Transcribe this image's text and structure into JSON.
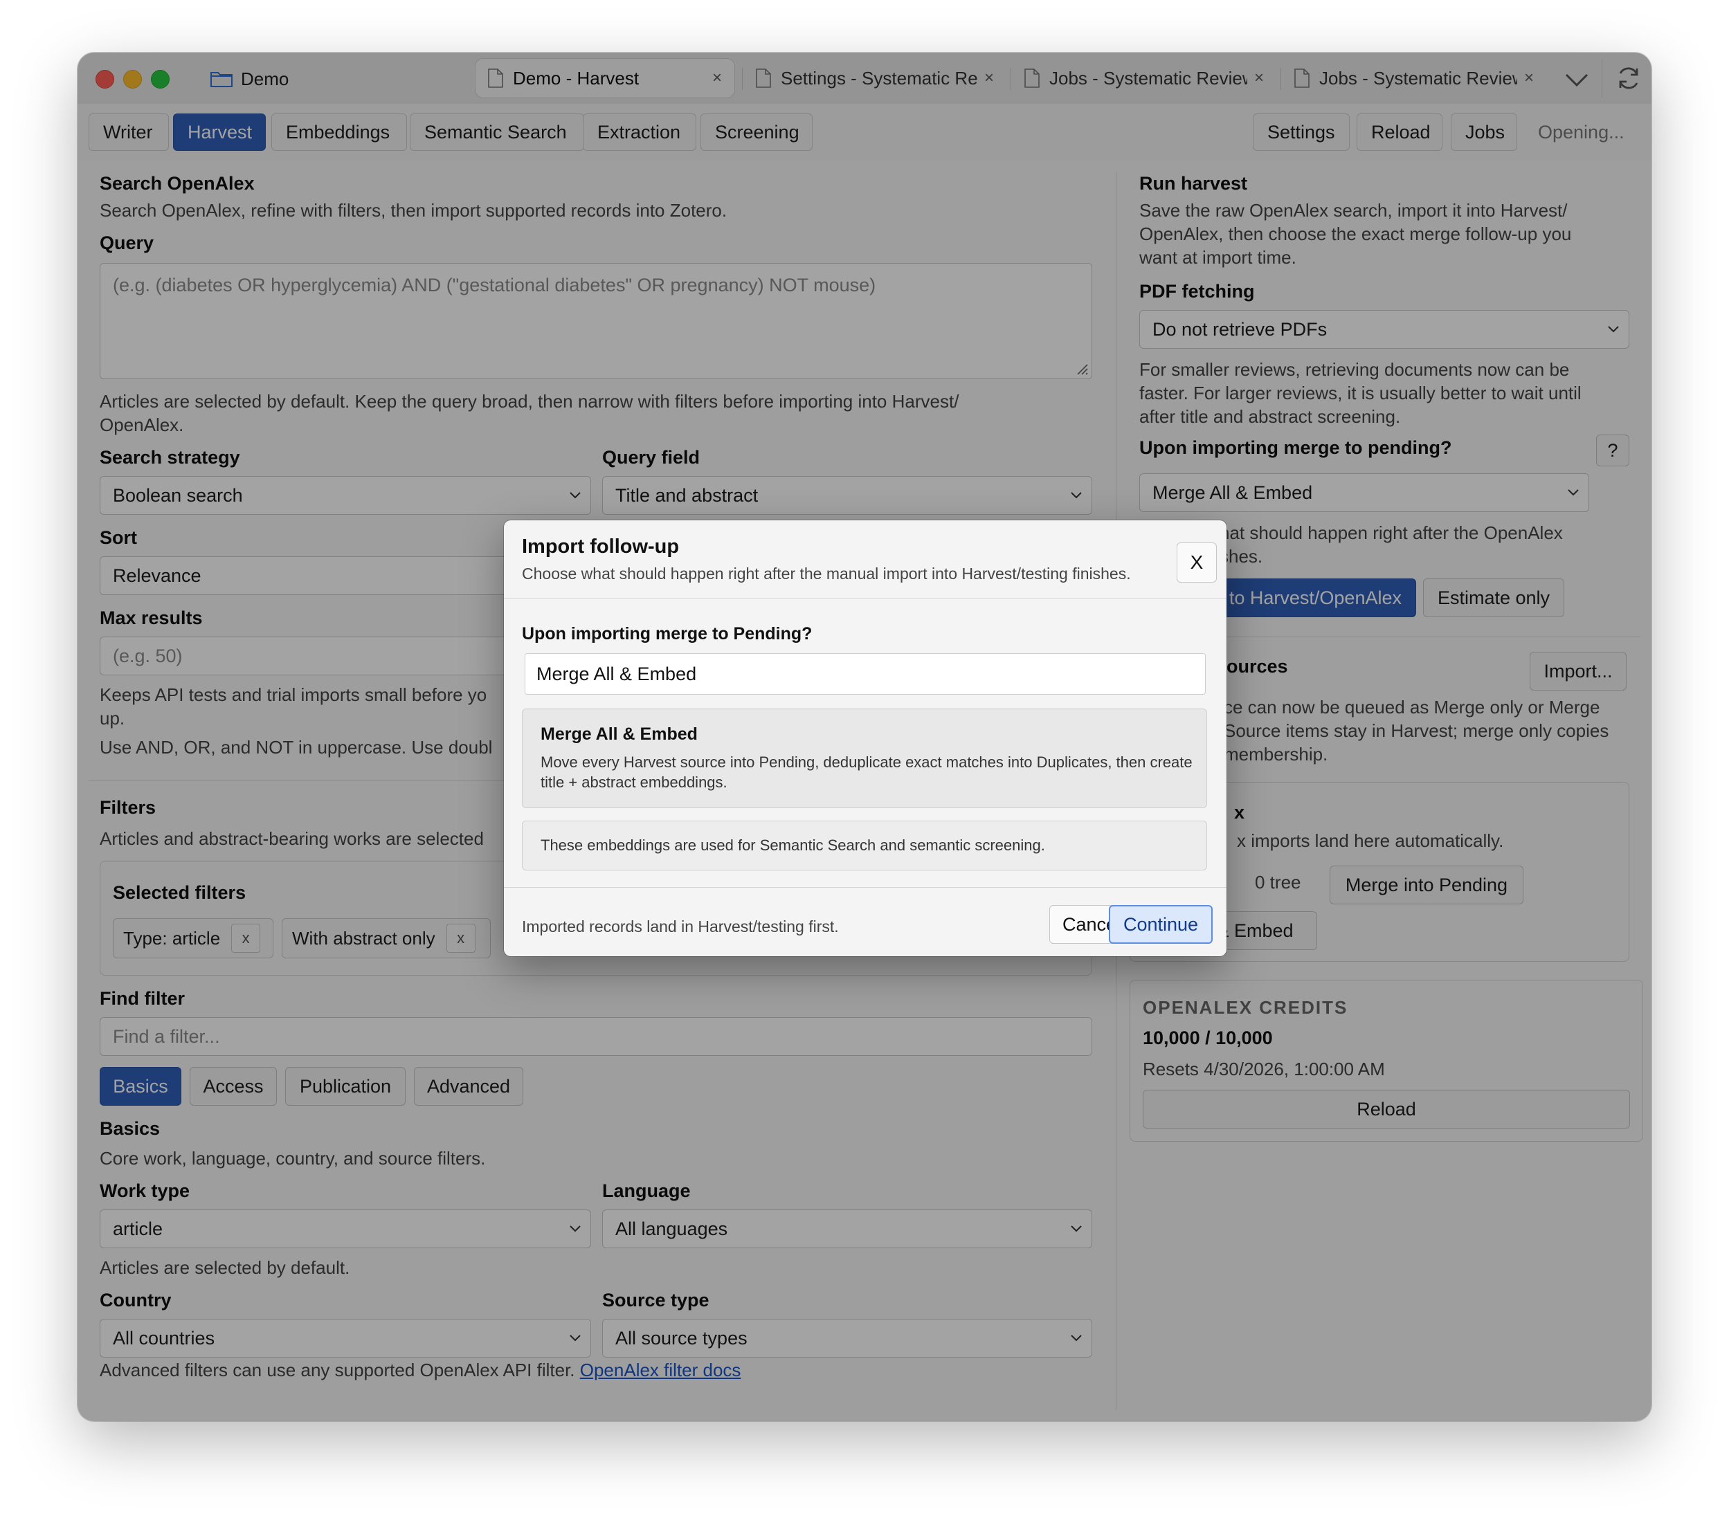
{
  "titlebar": {
    "folder_label": "Demo",
    "tabs": [
      {
        "label": "Demo - Harvest",
        "active": true
      },
      {
        "label": "Settings - Systematic Review"
      },
      {
        "label": "Jobs - Systematic Review"
      },
      {
        "label": "Jobs - Systematic Review"
      }
    ],
    "close_glyph": "×"
  },
  "toolbar": {
    "left_tabs": [
      "Writer",
      "Harvest",
      "Embeddings",
      "Semantic Search",
      "Extraction",
      "Screening"
    ],
    "active_tab": "Harvest",
    "right_buttons": [
      "Settings",
      "Reload",
      "Jobs"
    ],
    "status": "Opening..."
  },
  "search": {
    "title": "Search OpenAlex",
    "desc": "Search OpenAlex, refine with filters, then import supported records into Zotero.",
    "query_label": "Query",
    "query_placeholder": "(e.g. (diabetes OR hyperglycemia) AND (\"gestational diabetes\" OR pregnancy) NOT mouse)",
    "query_help_1": "Articles are selected by default. Keep the query broad, then narrow with filters before importing into Harvest/",
    "query_help_2": "OpenAlex.",
    "strategy_label": "Search strategy",
    "strategy_value": "Boolean search",
    "field_label": "Query field",
    "field_value": "Title and abstract",
    "sort_label": "Sort",
    "sort_value": "Relevance",
    "max_label": "Max results",
    "max_placeholder": "(e.g. 50)",
    "max_help_1": "Keeps API tests and trial imports small before yo",
    "max_help_2": "up.",
    "ops_help": "Use AND, OR, and NOT in uppercase. Use doubl"
  },
  "filters": {
    "title": "Filters",
    "desc": "Articles and abstract-bearing works are selected",
    "selected_title": "Selected filters",
    "chips": [
      "Type: article",
      "With abstract only"
    ],
    "chip_remove": "x",
    "find_label": "Find filter",
    "find_placeholder": "Find a filter...",
    "tabs": [
      "Basics",
      "Access",
      "Publication",
      "Advanced"
    ],
    "active_tab": "Basics",
    "basics_title": "Basics",
    "basics_desc": "Core work, language, country, and source filters.",
    "work_type_label": "Work type",
    "work_type_value": "article",
    "language_label": "Language",
    "language_value": "All languages",
    "work_help": "Articles are selected by default.",
    "country_label": "Country",
    "country_value": "All countries",
    "source_label": "Source type",
    "source_value": "All source types",
    "adv_help": "Advanced filters can use any supported OpenAlex API filter.",
    "docs_link": "OpenAlex filter docs"
  },
  "run": {
    "title": "Run harvest",
    "desc_1": "Save the raw OpenAlex search, import it into Harvest/",
    "desc_2": "OpenAlex, then choose the exact merge follow-up you",
    "desc_3": "want at import time.",
    "pdf_label": "PDF fetching",
    "pdf_value": "Do not retrieve PDFs",
    "pdf_help_1": "For smaller reviews, retrieving documents now can be",
    "pdf_help_2": "faster. For larger reviews, it is usually better to wait until",
    "pdf_help_3": "after title and abstract screening.",
    "merge_label": "Upon importing merge to pending?",
    "merge_help_btn": "?",
    "merge_value": "Merge All & Embed",
    "merge_help_1": "hat should happen right after the OpenAlex",
    "merge_help_2": "shes.",
    "import_btn": "to Harvest/OpenAlex",
    "estimate_btn": "Estimate only"
  },
  "sources": {
    "title": "ources",
    "import_btn": "Import...",
    "help_1": "ce can now be queued as Merge only or Merge",
    "help_2": "Source items stay in Harvest; merge only copies",
    "help_3": "membership.",
    "box_title": "x",
    "box_desc": "x imports land here automatically.",
    "tree_count": "0 tree",
    "merge_pending_btn": "Merge into Pending",
    "embed_btn": "& Embed"
  },
  "credits": {
    "title": "OPENALEX CREDITS",
    "value": "10,000 / 10,000",
    "resets": "Resets 4/30/2026, 1:00:00 AM",
    "reload_btn": "Reload"
  },
  "modal": {
    "title": "Import follow-up",
    "subtitle": "Choose what should happen right after the manual import into Harvest/testing finishes.",
    "close": "X",
    "label": "Upon importing merge to Pending?",
    "selected": "Merge All & Embed",
    "option_title": "Merge All & Embed",
    "option_desc": "Move every Harvest source into Pending, deduplicate exact matches into Duplicates, then create title + abstract embeddings.",
    "note": "These embeddings are used for Semantic Search and semantic screening.",
    "footer": "Imported records land in Harvest/testing first.",
    "cancel": "Cancel",
    "continue": "Continue"
  }
}
